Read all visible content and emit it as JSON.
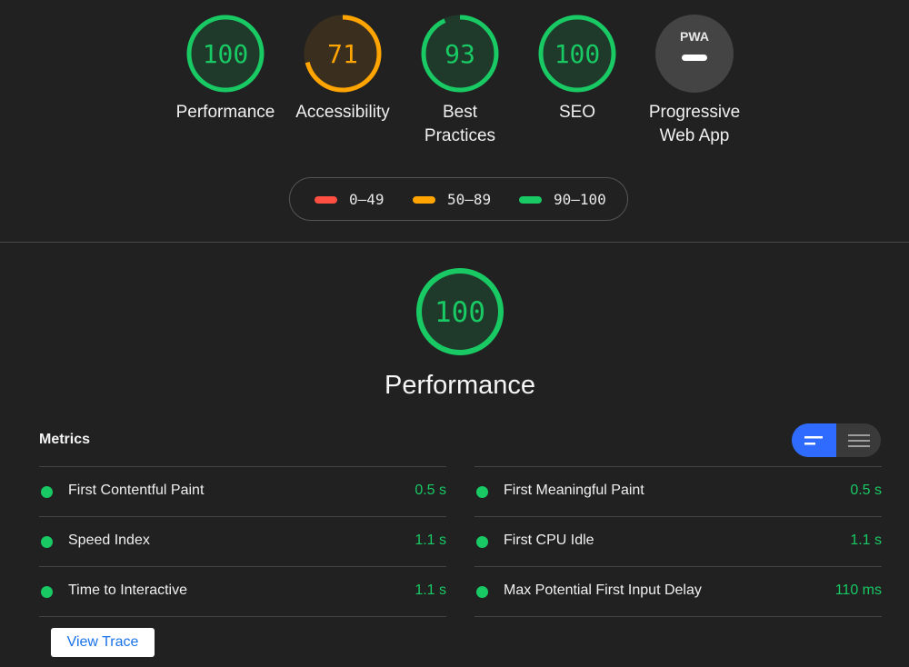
{
  "colors": {
    "pass": "#18c964",
    "average": "#ffa400",
    "fail": "#ff4e42",
    "accent": "#2f6bff"
  },
  "categories": [
    {
      "score": "100",
      "label_line1": "Performance",
      "label_line2": "",
      "status": "pass",
      "value": 100
    },
    {
      "score": "71",
      "label_line1": "Accessibility",
      "label_line2": "",
      "status": "average",
      "value": 71
    },
    {
      "score": "93",
      "label_line1": "Best",
      "label_line2": "Practices",
      "status": "pass",
      "value": 93
    },
    {
      "score": "100",
      "label_line1": "SEO",
      "label_line2": "",
      "status": "pass",
      "value": 100
    },
    {
      "badge": "PWA",
      "label_line1": "Progressive",
      "label_line2": "Web App",
      "status": "na"
    }
  ],
  "legend": [
    {
      "range": "0–49",
      "status": "fail"
    },
    {
      "range": "50–89",
      "status": "average"
    },
    {
      "range": "90–100",
      "status": "pass"
    }
  ],
  "main_score": {
    "score": "100",
    "title": "Performance",
    "value": 100
  },
  "metrics": {
    "title": "Metrics",
    "toggle_icons": [
      "summary-view-icon",
      "list-view-icon"
    ],
    "left": [
      {
        "name": "First Contentful Paint",
        "value": "0.5 s"
      },
      {
        "name": "Speed Index",
        "value": "1.1 s"
      },
      {
        "name": "Time to Interactive",
        "value": "1.1 s"
      }
    ],
    "right": [
      {
        "name": "First Meaningful Paint",
        "value": "0.5 s"
      },
      {
        "name": "First CPU Idle",
        "value": "1.1 s"
      },
      {
        "name": "Max Potential First Input Delay",
        "value": "110 ms"
      }
    ]
  },
  "view_trace_label": "View Trace"
}
